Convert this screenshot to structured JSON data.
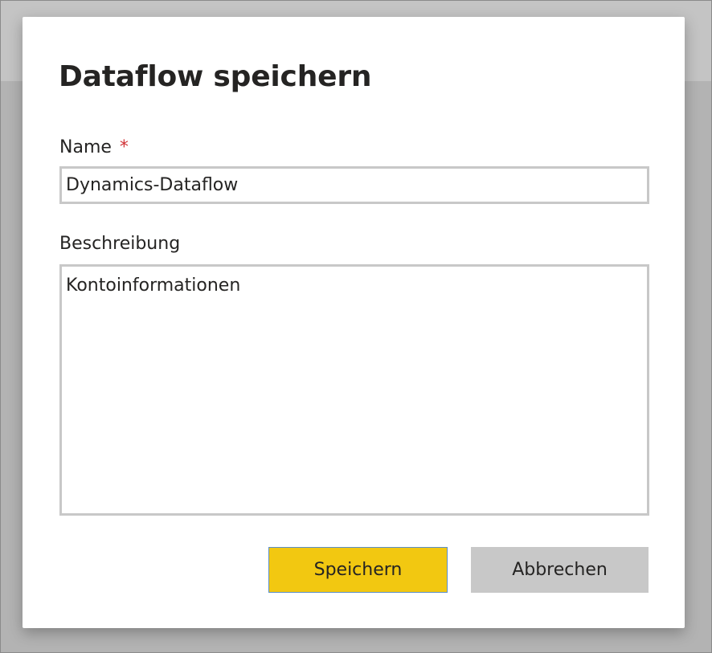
{
  "dialog": {
    "title": "Dataflow speichern",
    "name_field": {
      "label": "Name",
      "required_marker": "*",
      "value": "Dynamics-Dataflow"
    },
    "description_field": {
      "label": "Beschreibung",
      "value": "Kontoinformationen"
    },
    "buttons": {
      "save_label": "Speichern",
      "cancel_label": "Abbrechen"
    }
  },
  "colors": {
    "save_button": "#f2c811",
    "cancel_button": "#c8c8c8",
    "required_marker": "#d13438",
    "overlay_background": "#b3b3b3"
  }
}
